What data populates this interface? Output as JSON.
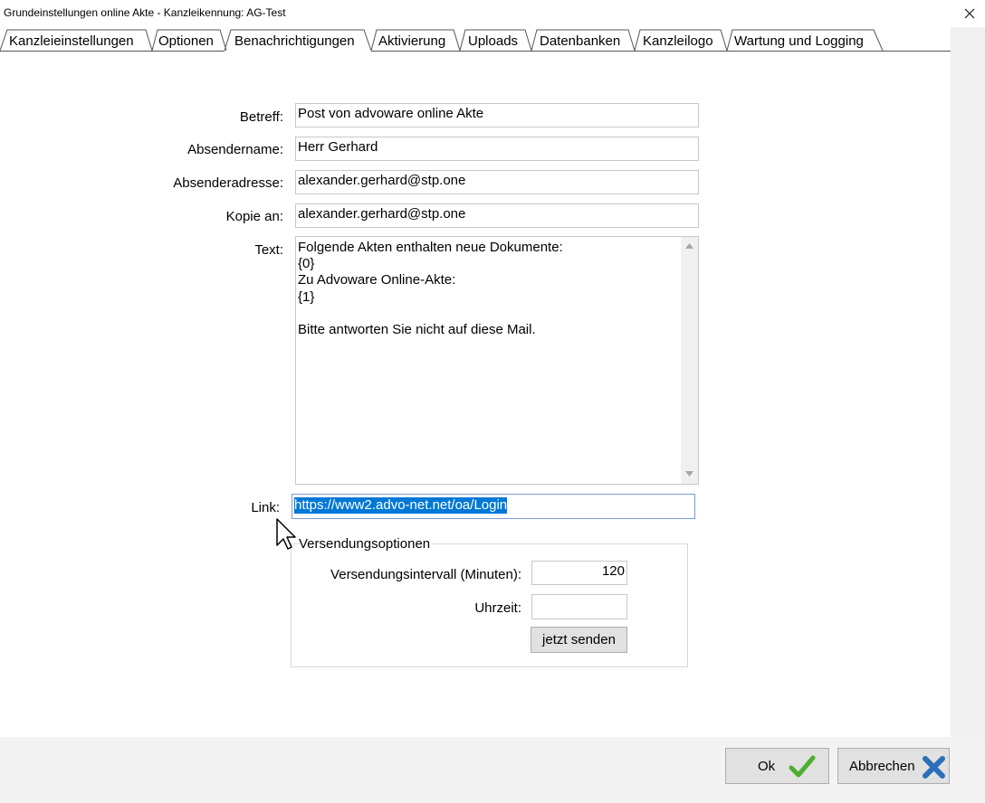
{
  "window": {
    "title": "Grundeinstellungen online Akte - Kanzleikennung: AG-Test"
  },
  "tabs": [
    {
      "label": "Kanzleieinstellungen",
      "selected": false
    },
    {
      "label": "Optionen",
      "selected": false
    },
    {
      "label": "Benachrichtigungen",
      "selected": true
    },
    {
      "label": "Aktivierung",
      "selected": false
    },
    {
      "label": "Uploads",
      "selected": false
    },
    {
      "label": "Datenbanken",
      "selected": false
    },
    {
      "label": "Kanzleilogo",
      "selected": false
    },
    {
      "label": "Wartung und Logging",
      "selected": false
    }
  ],
  "form": {
    "betreff_label": "Betreff:",
    "betreff_value": "Post von advoware online Akte",
    "absendername_label": "Absendername:",
    "absendername_value": "Herr Gerhard",
    "absenderadresse_label": "Absenderadresse:",
    "absenderadresse_value": "alexander.gerhard@stp.one",
    "kopie_label": "Kopie an:",
    "kopie_value": "alexander.gerhard@stp.one",
    "text_label": "Text:",
    "text_value": "Folgende Akten enthalten neue Dokumente:\n{0}\nZu Advoware Online-Akte:\n{1}\n\nBitte antworten Sie nicht auf diese Mail.",
    "link_label": "Link:",
    "link_value": "https://www2.advo-net.net/oa/Login"
  },
  "versand": {
    "group_title": "Versendungsoptionen",
    "intervall_label": "Versendungsintervall (Minuten):",
    "intervall_value": "120",
    "uhrzeit_label": "Uhrzeit:",
    "uhrzeit_value": "",
    "send_now_label": "jetzt senden"
  },
  "footer": {
    "ok_label": "Ok",
    "cancel_label": "Abbrechen"
  },
  "icons": {
    "close": "close-icon",
    "ok": "checkmark-icon",
    "cancel": "x-cross-icon",
    "cursor": "mouse-pointer-icon"
  },
  "colors": {
    "selection": "#0078d7",
    "ok_check": "#4caf2f",
    "cancel_cross": "#2b6fb8"
  }
}
